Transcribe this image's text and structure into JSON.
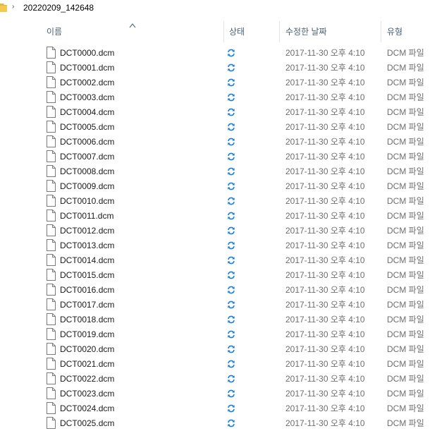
{
  "breadcrumb": {
    "folder_icon": "folder-icon",
    "separator": "›",
    "current": "20220209_142648"
  },
  "columns": {
    "name": "이름",
    "status": "상태",
    "modified": "수정한 날짜",
    "type": "유형",
    "sorted_by": "name",
    "sort_direction": "ascending"
  },
  "files": [
    {
      "name": "DCT0000.dcm",
      "status_icon": "sync-icon",
      "modified": "2017-11-30 오후 4:10",
      "type": "DCM 파일"
    },
    {
      "name": "DCT0001.dcm",
      "status_icon": "sync-icon",
      "modified": "2017-11-30 오후 4:10",
      "type": "DCM 파일"
    },
    {
      "name": "DCT0002.dcm",
      "status_icon": "sync-icon",
      "modified": "2017-11-30 오후 4:10",
      "type": "DCM 파일"
    },
    {
      "name": "DCT0003.dcm",
      "status_icon": "sync-icon",
      "modified": "2017-11-30 오후 4:10",
      "type": "DCM 파일"
    },
    {
      "name": "DCT0004.dcm",
      "status_icon": "sync-icon",
      "modified": "2017-11-30 오후 4:10",
      "type": "DCM 파일"
    },
    {
      "name": "DCT0005.dcm",
      "status_icon": "sync-icon",
      "modified": "2017-11-30 오후 4:10",
      "type": "DCM 파일"
    },
    {
      "name": "DCT0006.dcm",
      "status_icon": "sync-icon",
      "modified": "2017-11-30 오후 4:10",
      "type": "DCM 파일"
    },
    {
      "name": "DCT0007.dcm",
      "status_icon": "sync-icon",
      "modified": "2017-11-30 오후 4:10",
      "type": "DCM 파일"
    },
    {
      "name": "DCT0008.dcm",
      "status_icon": "sync-icon",
      "modified": "2017-11-30 오후 4:10",
      "type": "DCM 파일"
    },
    {
      "name": "DCT0009.dcm",
      "status_icon": "sync-icon",
      "modified": "2017-11-30 오후 4:10",
      "type": "DCM 파일"
    },
    {
      "name": "DCT0010.dcm",
      "status_icon": "sync-icon",
      "modified": "2017-11-30 오후 4:10",
      "type": "DCM 파일"
    },
    {
      "name": "DCT0011.dcm",
      "status_icon": "sync-icon",
      "modified": "2017-11-30 오후 4:10",
      "type": "DCM 파일"
    },
    {
      "name": "DCT0012.dcm",
      "status_icon": "sync-icon",
      "modified": "2017-11-30 오후 4:10",
      "type": "DCM 파일"
    },
    {
      "name": "DCT0013.dcm",
      "status_icon": "sync-icon",
      "modified": "2017-11-30 오후 4:10",
      "type": "DCM 파일"
    },
    {
      "name": "DCT0014.dcm",
      "status_icon": "sync-icon",
      "modified": "2017-11-30 오후 4:10",
      "type": "DCM 파일"
    },
    {
      "name": "DCT0015.dcm",
      "status_icon": "sync-icon",
      "modified": "2017-11-30 오후 4:10",
      "type": "DCM 파일"
    },
    {
      "name": "DCT0016.dcm",
      "status_icon": "sync-icon",
      "modified": "2017-11-30 오후 4:10",
      "type": "DCM 파일"
    },
    {
      "name": "DCT0017.dcm",
      "status_icon": "sync-icon",
      "modified": "2017-11-30 오후 4:10",
      "type": "DCM 파일"
    },
    {
      "name": "DCT0018.dcm",
      "status_icon": "sync-icon",
      "modified": "2017-11-30 오후 4:10",
      "type": "DCM 파일"
    },
    {
      "name": "DCT0019.dcm",
      "status_icon": "sync-icon",
      "modified": "2017-11-30 오후 4:10",
      "type": "DCM 파일"
    },
    {
      "name": "DCT0020.dcm",
      "status_icon": "sync-icon",
      "modified": "2017-11-30 오후 4:10",
      "type": "DCM 파일"
    },
    {
      "name": "DCT0021.dcm",
      "status_icon": "sync-icon",
      "modified": "2017-11-30 오후 4:10",
      "type": "DCM 파일"
    },
    {
      "name": "DCT0022.dcm",
      "status_icon": "sync-icon",
      "modified": "2017-11-30 오후 4:10",
      "type": "DCM 파일"
    },
    {
      "name": "DCT0023.dcm",
      "status_icon": "sync-icon",
      "modified": "2017-11-30 오후 4:10",
      "type": "DCM 파일"
    },
    {
      "name": "DCT0024.dcm",
      "status_icon": "sync-icon",
      "modified": "2017-11-30 오후 4:10",
      "type": "DCM 파일"
    },
    {
      "name": "DCT0025.dcm",
      "status_icon": "sync-icon",
      "modified": "2017-11-30 오후 4:10",
      "type": "DCM 파일"
    }
  ],
  "colors": {
    "header_text": "#4c607a",
    "sync_icon": "#1e7fd8",
    "folder": "#e8b640",
    "muted_text": "#6d6d6d"
  }
}
